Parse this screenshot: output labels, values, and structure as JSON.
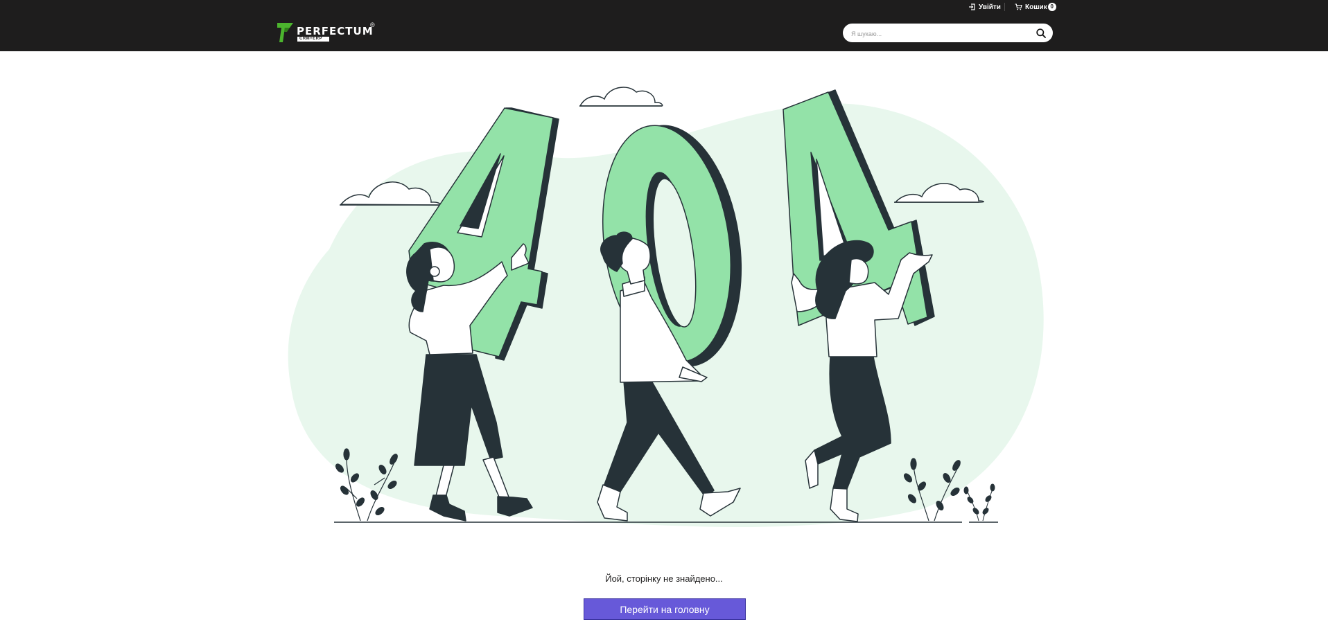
{
  "topbar": {
    "login_label": "Увійти",
    "cart_label": "Кошик",
    "cart_count": "0"
  },
  "header": {
    "brand": "PERFECTUM",
    "brand_mark": "®",
    "brand_sub": "CRM+ERP",
    "search_placeholder": "Я шукаю..."
  },
  "error": {
    "message": "Йой, сторінку не знайдено...",
    "button_label": "Перейти на головну"
  },
  "colors": {
    "header_bg": "#1e1d1d",
    "accent_green": "#93e2a8",
    "blob_green": "#e8f7ed",
    "dark": "#263238",
    "button": "#6759d9",
    "logo_green": "#4cb52e"
  }
}
